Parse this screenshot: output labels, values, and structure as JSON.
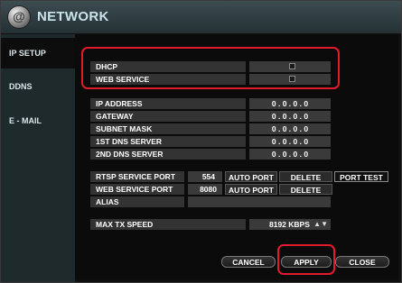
{
  "title": "NETWORK",
  "logo_glyph": "@",
  "sidebar": {
    "items": [
      {
        "label": "IP SETUP"
      },
      {
        "label": "DDNS"
      },
      {
        "label": "E - MAIL"
      }
    ]
  },
  "toggles": {
    "dhcp_label": "DHCP",
    "web_service_label": "WEB SERVICE"
  },
  "ip": {
    "address_label": "IP ADDRESS",
    "address_value": "0 . 0 . 0 . 0",
    "gateway_label": "GATEWAY",
    "gateway_value": "0 . 0 . 0 . 0",
    "subnet_label": "SUBNET MASK",
    "subnet_value": "0 . 0 . 0 . 0",
    "dns1_label": "1ST DNS SERVER",
    "dns1_value": "0 . 0 . 0 . 0",
    "dns2_label": "2ND DNS SERVER",
    "dns2_value": "0 . 0 . 0 . 0"
  },
  "ports": {
    "rtsp_label": "RTSP SERVICE PORT",
    "rtsp_value": "554",
    "web_label": "WEB SERVICE PORT",
    "web_value": "8080",
    "auto_port": "AUTO PORT",
    "delete_port": "DELETE PORT",
    "port_test": "PORT TEST",
    "alias_label": "ALIAS",
    "alias_value": ""
  },
  "tx": {
    "label": "MAX TX SPEED",
    "value": "8192 KBPS"
  },
  "footer": {
    "cancel": "CANCEL",
    "apply": "APPLY",
    "close": "CLOSE"
  },
  "colors": {
    "highlight": "#e21b2c",
    "title_text": "#c9e4ea"
  }
}
